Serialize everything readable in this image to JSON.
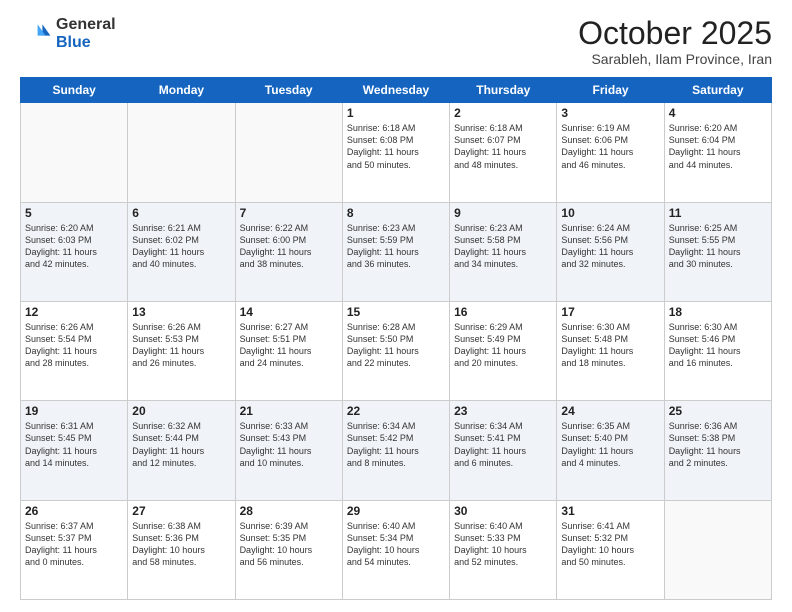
{
  "logo": {
    "general": "General",
    "blue": "Blue"
  },
  "header": {
    "month": "October 2025",
    "location": "Sarableh, Ilam Province, Iran"
  },
  "weekdays": [
    "Sunday",
    "Monday",
    "Tuesday",
    "Wednesday",
    "Thursday",
    "Friday",
    "Saturday"
  ],
  "weeks": [
    [
      {
        "day": "",
        "info": ""
      },
      {
        "day": "",
        "info": ""
      },
      {
        "day": "",
        "info": ""
      },
      {
        "day": "1",
        "info": "Sunrise: 6:18 AM\nSunset: 6:08 PM\nDaylight: 11 hours\nand 50 minutes."
      },
      {
        "day": "2",
        "info": "Sunrise: 6:18 AM\nSunset: 6:07 PM\nDaylight: 11 hours\nand 48 minutes."
      },
      {
        "day": "3",
        "info": "Sunrise: 6:19 AM\nSunset: 6:06 PM\nDaylight: 11 hours\nand 46 minutes."
      },
      {
        "day": "4",
        "info": "Sunrise: 6:20 AM\nSunset: 6:04 PM\nDaylight: 11 hours\nand 44 minutes."
      }
    ],
    [
      {
        "day": "5",
        "info": "Sunrise: 6:20 AM\nSunset: 6:03 PM\nDaylight: 11 hours\nand 42 minutes."
      },
      {
        "day": "6",
        "info": "Sunrise: 6:21 AM\nSunset: 6:02 PM\nDaylight: 11 hours\nand 40 minutes."
      },
      {
        "day": "7",
        "info": "Sunrise: 6:22 AM\nSunset: 6:00 PM\nDaylight: 11 hours\nand 38 minutes."
      },
      {
        "day": "8",
        "info": "Sunrise: 6:23 AM\nSunset: 5:59 PM\nDaylight: 11 hours\nand 36 minutes."
      },
      {
        "day": "9",
        "info": "Sunrise: 6:23 AM\nSunset: 5:58 PM\nDaylight: 11 hours\nand 34 minutes."
      },
      {
        "day": "10",
        "info": "Sunrise: 6:24 AM\nSunset: 5:56 PM\nDaylight: 11 hours\nand 32 minutes."
      },
      {
        "day": "11",
        "info": "Sunrise: 6:25 AM\nSunset: 5:55 PM\nDaylight: 11 hours\nand 30 minutes."
      }
    ],
    [
      {
        "day": "12",
        "info": "Sunrise: 6:26 AM\nSunset: 5:54 PM\nDaylight: 11 hours\nand 28 minutes."
      },
      {
        "day": "13",
        "info": "Sunrise: 6:26 AM\nSunset: 5:53 PM\nDaylight: 11 hours\nand 26 minutes."
      },
      {
        "day": "14",
        "info": "Sunrise: 6:27 AM\nSunset: 5:51 PM\nDaylight: 11 hours\nand 24 minutes."
      },
      {
        "day": "15",
        "info": "Sunrise: 6:28 AM\nSunset: 5:50 PM\nDaylight: 11 hours\nand 22 minutes."
      },
      {
        "day": "16",
        "info": "Sunrise: 6:29 AM\nSunset: 5:49 PM\nDaylight: 11 hours\nand 20 minutes."
      },
      {
        "day": "17",
        "info": "Sunrise: 6:30 AM\nSunset: 5:48 PM\nDaylight: 11 hours\nand 18 minutes."
      },
      {
        "day": "18",
        "info": "Sunrise: 6:30 AM\nSunset: 5:46 PM\nDaylight: 11 hours\nand 16 minutes."
      }
    ],
    [
      {
        "day": "19",
        "info": "Sunrise: 6:31 AM\nSunset: 5:45 PM\nDaylight: 11 hours\nand 14 minutes."
      },
      {
        "day": "20",
        "info": "Sunrise: 6:32 AM\nSunset: 5:44 PM\nDaylight: 11 hours\nand 12 minutes."
      },
      {
        "day": "21",
        "info": "Sunrise: 6:33 AM\nSunset: 5:43 PM\nDaylight: 11 hours\nand 10 minutes."
      },
      {
        "day": "22",
        "info": "Sunrise: 6:34 AM\nSunset: 5:42 PM\nDaylight: 11 hours\nand 8 minutes."
      },
      {
        "day": "23",
        "info": "Sunrise: 6:34 AM\nSunset: 5:41 PM\nDaylight: 11 hours\nand 6 minutes."
      },
      {
        "day": "24",
        "info": "Sunrise: 6:35 AM\nSunset: 5:40 PM\nDaylight: 11 hours\nand 4 minutes."
      },
      {
        "day": "25",
        "info": "Sunrise: 6:36 AM\nSunset: 5:38 PM\nDaylight: 11 hours\nand 2 minutes."
      }
    ],
    [
      {
        "day": "26",
        "info": "Sunrise: 6:37 AM\nSunset: 5:37 PM\nDaylight: 11 hours\nand 0 minutes."
      },
      {
        "day": "27",
        "info": "Sunrise: 6:38 AM\nSunset: 5:36 PM\nDaylight: 10 hours\nand 58 minutes."
      },
      {
        "day": "28",
        "info": "Sunrise: 6:39 AM\nSunset: 5:35 PM\nDaylight: 10 hours\nand 56 minutes."
      },
      {
        "day": "29",
        "info": "Sunrise: 6:40 AM\nSunset: 5:34 PM\nDaylight: 10 hours\nand 54 minutes."
      },
      {
        "day": "30",
        "info": "Sunrise: 6:40 AM\nSunset: 5:33 PM\nDaylight: 10 hours\nand 52 minutes."
      },
      {
        "day": "31",
        "info": "Sunrise: 6:41 AM\nSunset: 5:32 PM\nDaylight: 10 hours\nand 50 minutes."
      },
      {
        "day": "",
        "info": ""
      }
    ]
  ]
}
